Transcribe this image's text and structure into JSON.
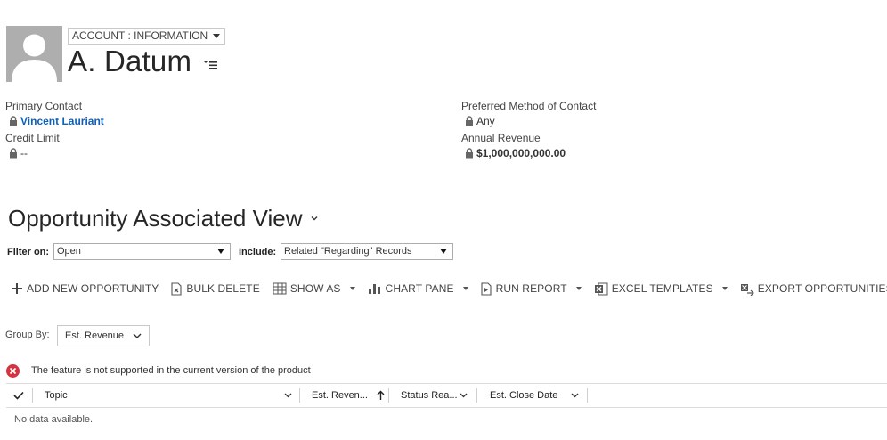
{
  "header": {
    "form_selector": "ACCOUNT : INFORMATION",
    "record_title": "A. Datum"
  },
  "fields": {
    "primary_contact": {
      "label": "Primary Contact",
      "value": "Vincent Lauriant"
    },
    "credit_limit": {
      "label": "Credit Limit",
      "value": "--"
    },
    "preferred_contact": {
      "label": "Preferred Method of Contact",
      "value": "Any"
    },
    "annual_revenue": {
      "label": "Annual Revenue",
      "value": "$1,000,000,000.00"
    }
  },
  "subgrid": {
    "view_title": "Opportunity Associated View",
    "filter_label": "Filter on:",
    "filter_value": "Open",
    "include_label": "Include:",
    "include_value": "Related \"Regarding\" Records"
  },
  "commands": {
    "add_new": "ADD NEW OPPORTUNITY",
    "bulk_delete": "BULK DELETE",
    "show_as": "SHOW AS",
    "chart_pane": "CHART PANE",
    "run_report": "RUN REPORT",
    "excel_templates": "EXCEL TEMPLATES",
    "export": "EXPORT OPPORTUNITIES"
  },
  "group_by": {
    "label": "Group By:",
    "value": "Est. Revenue"
  },
  "notification": {
    "text": "The feature is not supported in the current version of the product"
  },
  "grid": {
    "columns": [
      "Topic",
      "Est. Reven...",
      "Status Rea...",
      "Est. Close Date"
    ],
    "empty_text": "No data available."
  },
  "colors": {
    "link": "#1160b7",
    "error": "#d4333f",
    "avatar_bg": "#aeaeae"
  }
}
